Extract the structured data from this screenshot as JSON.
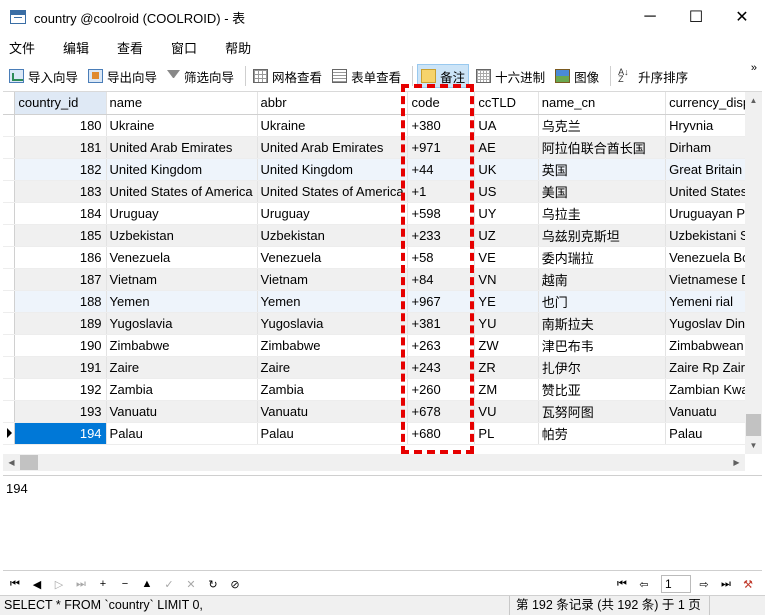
{
  "window": {
    "title": "country @coolroid (COOLROID) - 表",
    "minimize": "─",
    "maximize": "☐",
    "close": "✕"
  },
  "menu": [
    "文件",
    "编辑",
    "查看",
    "窗口",
    "帮助"
  ],
  "toolbar": {
    "import": "导入向导",
    "export": "导出向导",
    "filter": "筛选向导",
    "grid_view": "网格查看",
    "form_view": "表单查看",
    "memo": "备注",
    "hex": "十六进制",
    "image": "图像",
    "sort": "升序排序",
    "more": "»"
  },
  "grid": {
    "columns": [
      "country_id",
      "name",
      "abbr",
      "code",
      "ccTLD",
      "name_cn",
      "currency_disp"
    ],
    "rows": [
      [
        "180",
        "Ukraine",
        "Ukraine",
        "+380",
        "UA",
        "乌克兰",
        "Hryvnia"
      ],
      [
        "181",
        "United Arab Emirates",
        "United Arab Emirates",
        "+971",
        "AE",
        "阿拉伯联合酋长国",
        "Dirham"
      ],
      [
        "182",
        "United Kingdom",
        "United Kingdom",
        "+44",
        "UK",
        "英国",
        "Great Britain"
      ],
      [
        "183",
        "United States of America",
        "United States of America",
        "+1",
        "US",
        "美国",
        "United States"
      ],
      [
        "184",
        "Uruguay",
        "Uruguay",
        "+598",
        "UY",
        "乌拉圭",
        "Uruguayan Pe"
      ],
      [
        "185",
        "Uzbekistan",
        "Uzbekistan",
        "+233",
        "UZ",
        "乌兹别克斯坦",
        "Uzbekistani S"
      ],
      [
        "186",
        "Venezuela",
        "Venezuela",
        "+58",
        "VE",
        "委内瑞拉",
        "Venezuela Bo"
      ],
      [
        "187",
        "Vietnam",
        "Vietnam",
        "+84",
        "VN",
        "越南",
        "Vietnamese D"
      ],
      [
        "188",
        "Yemen",
        "Yemen",
        "+967",
        "YE",
        "也门",
        "Yemeni rial"
      ],
      [
        "189",
        "Yugoslavia",
        "Yugoslavia",
        "+381",
        "YU",
        "南斯拉夫",
        "Yugoslav Din"
      ],
      [
        "190",
        "Zimbabwe",
        "Zimbabwe",
        "+263",
        "ZW",
        "津巴布韦",
        "Zimbabwean"
      ],
      [
        "191",
        "Zaire",
        "Zaire",
        "+243",
        "ZR",
        "扎伊尔",
        "Zaire Rp Zair"
      ],
      [
        "192",
        "Zambia",
        "Zambia",
        "+260",
        "ZM",
        "赞比亚",
        "Zambian Kwa"
      ],
      [
        "193",
        "Vanuatu",
        "Vanuatu",
        "+678",
        "VU",
        "瓦努阿图",
        "Vanuatu"
      ],
      [
        "194",
        "Palau",
        "Palau",
        "+680",
        "PL",
        "帕劳",
        "Palau"
      ]
    ],
    "current_row": 14
  },
  "memo": {
    "value": "194"
  },
  "nav": {
    "first": "⏮",
    "prev": "◀",
    "next": "▷",
    "last": "⏭",
    "add": "+",
    "delete": "−",
    "up": "▲",
    "apply": "✓",
    "cancel": "✕",
    "refresh": "↻",
    "stop": "⊘",
    "page_first": "⏮",
    "page_prev": "⇦",
    "page_value": "1",
    "page_next": "⇨",
    "page_last": "⏭",
    "settings": "⚒"
  },
  "status": {
    "sql": "SELECT * FROM `country` LIMIT 0,",
    "records": "第 192 条记录 (共 192 条) 于 1 页"
  },
  "colors": {
    "selection": "#0078d7",
    "highlight": "#e60000",
    "header_selected": "#dfe9f5"
  }
}
